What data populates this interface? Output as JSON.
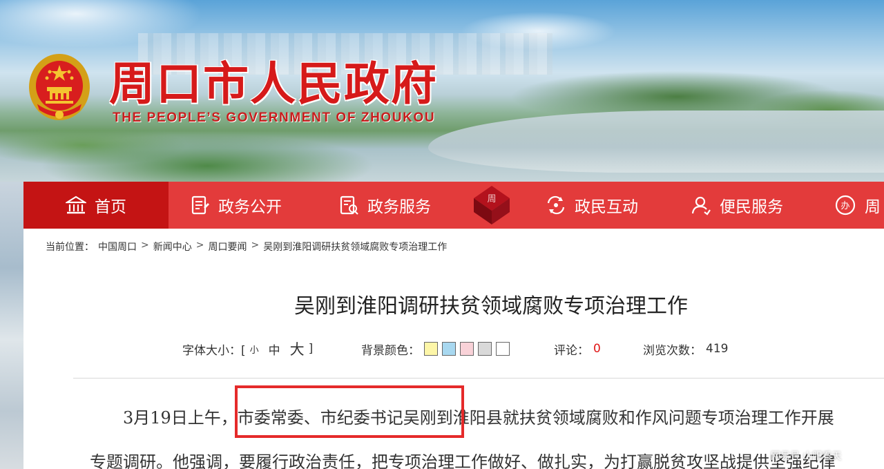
{
  "header": {
    "title": "周口市人民政府",
    "subtitle": "THE PEOPLE’S GOVERNMENT OF ZHOUKOU",
    "emblem_icon": "national-emblem-icon"
  },
  "nav": {
    "items": [
      {
        "label": "首页",
        "icon": "home-icon",
        "active": true
      },
      {
        "label": "政务公开",
        "icon": "document-icon"
      },
      {
        "label": "政务服务",
        "icon": "service-icon"
      },
      {
        "label": "政民互动",
        "icon": "interaction-icon"
      },
      {
        "label": "便民服务",
        "icon": "user-icon"
      },
      {
        "label": "周",
        "icon": "badge-icon"
      }
    ],
    "center_icon": "seal-icon"
  },
  "breadcrumb": {
    "prefix": "当前位置：",
    "items": [
      "中国周口",
      "新闻中心",
      "周口要闻",
      "吴刚到淮阳调研扶贫领域腐败专项治理工作"
    ],
    "separator": ">"
  },
  "article": {
    "title": "吴刚到淮阳调研扶贫领域腐败专项治理工作",
    "toolbar": {
      "font_size_label": "字体大小：[",
      "font_size_options": [
        "小",
        "中",
        "大"
      ],
      "font_size_close": "]",
      "bg_color_label": "背景颜色：",
      "bg_colors": [
        "#fdf6a8",
        "#a8d8f0",
        "#f9d2d8",
        "#d9d9d9",
        "#ffffff"
      ],
      "comment_label": "评论：",
      "comment_count": "0",
      "views_label": "浏览次数：",
      "views_count": "419"
    },
    "paragraph1": "3月19日上午，市委常委、市纪委书记吴刚到淮阳县就扶贫领域腐败和作风问题专项治理工作开展",
    "paragraph2": "专题调研。他强调，要履行政治责任，把专项治理工作做好、做扎实，为打赢脱贫攻坚战提供坚强纪律"
  },
  "watermark": "网易号 山阳看天",
  "colors": {
    "brand_red": "#e33b3b",
    "active_red": "#c41414",
    "title_red": "#d61a1a",
    "highlight": "#e52a2a"
  }
}
